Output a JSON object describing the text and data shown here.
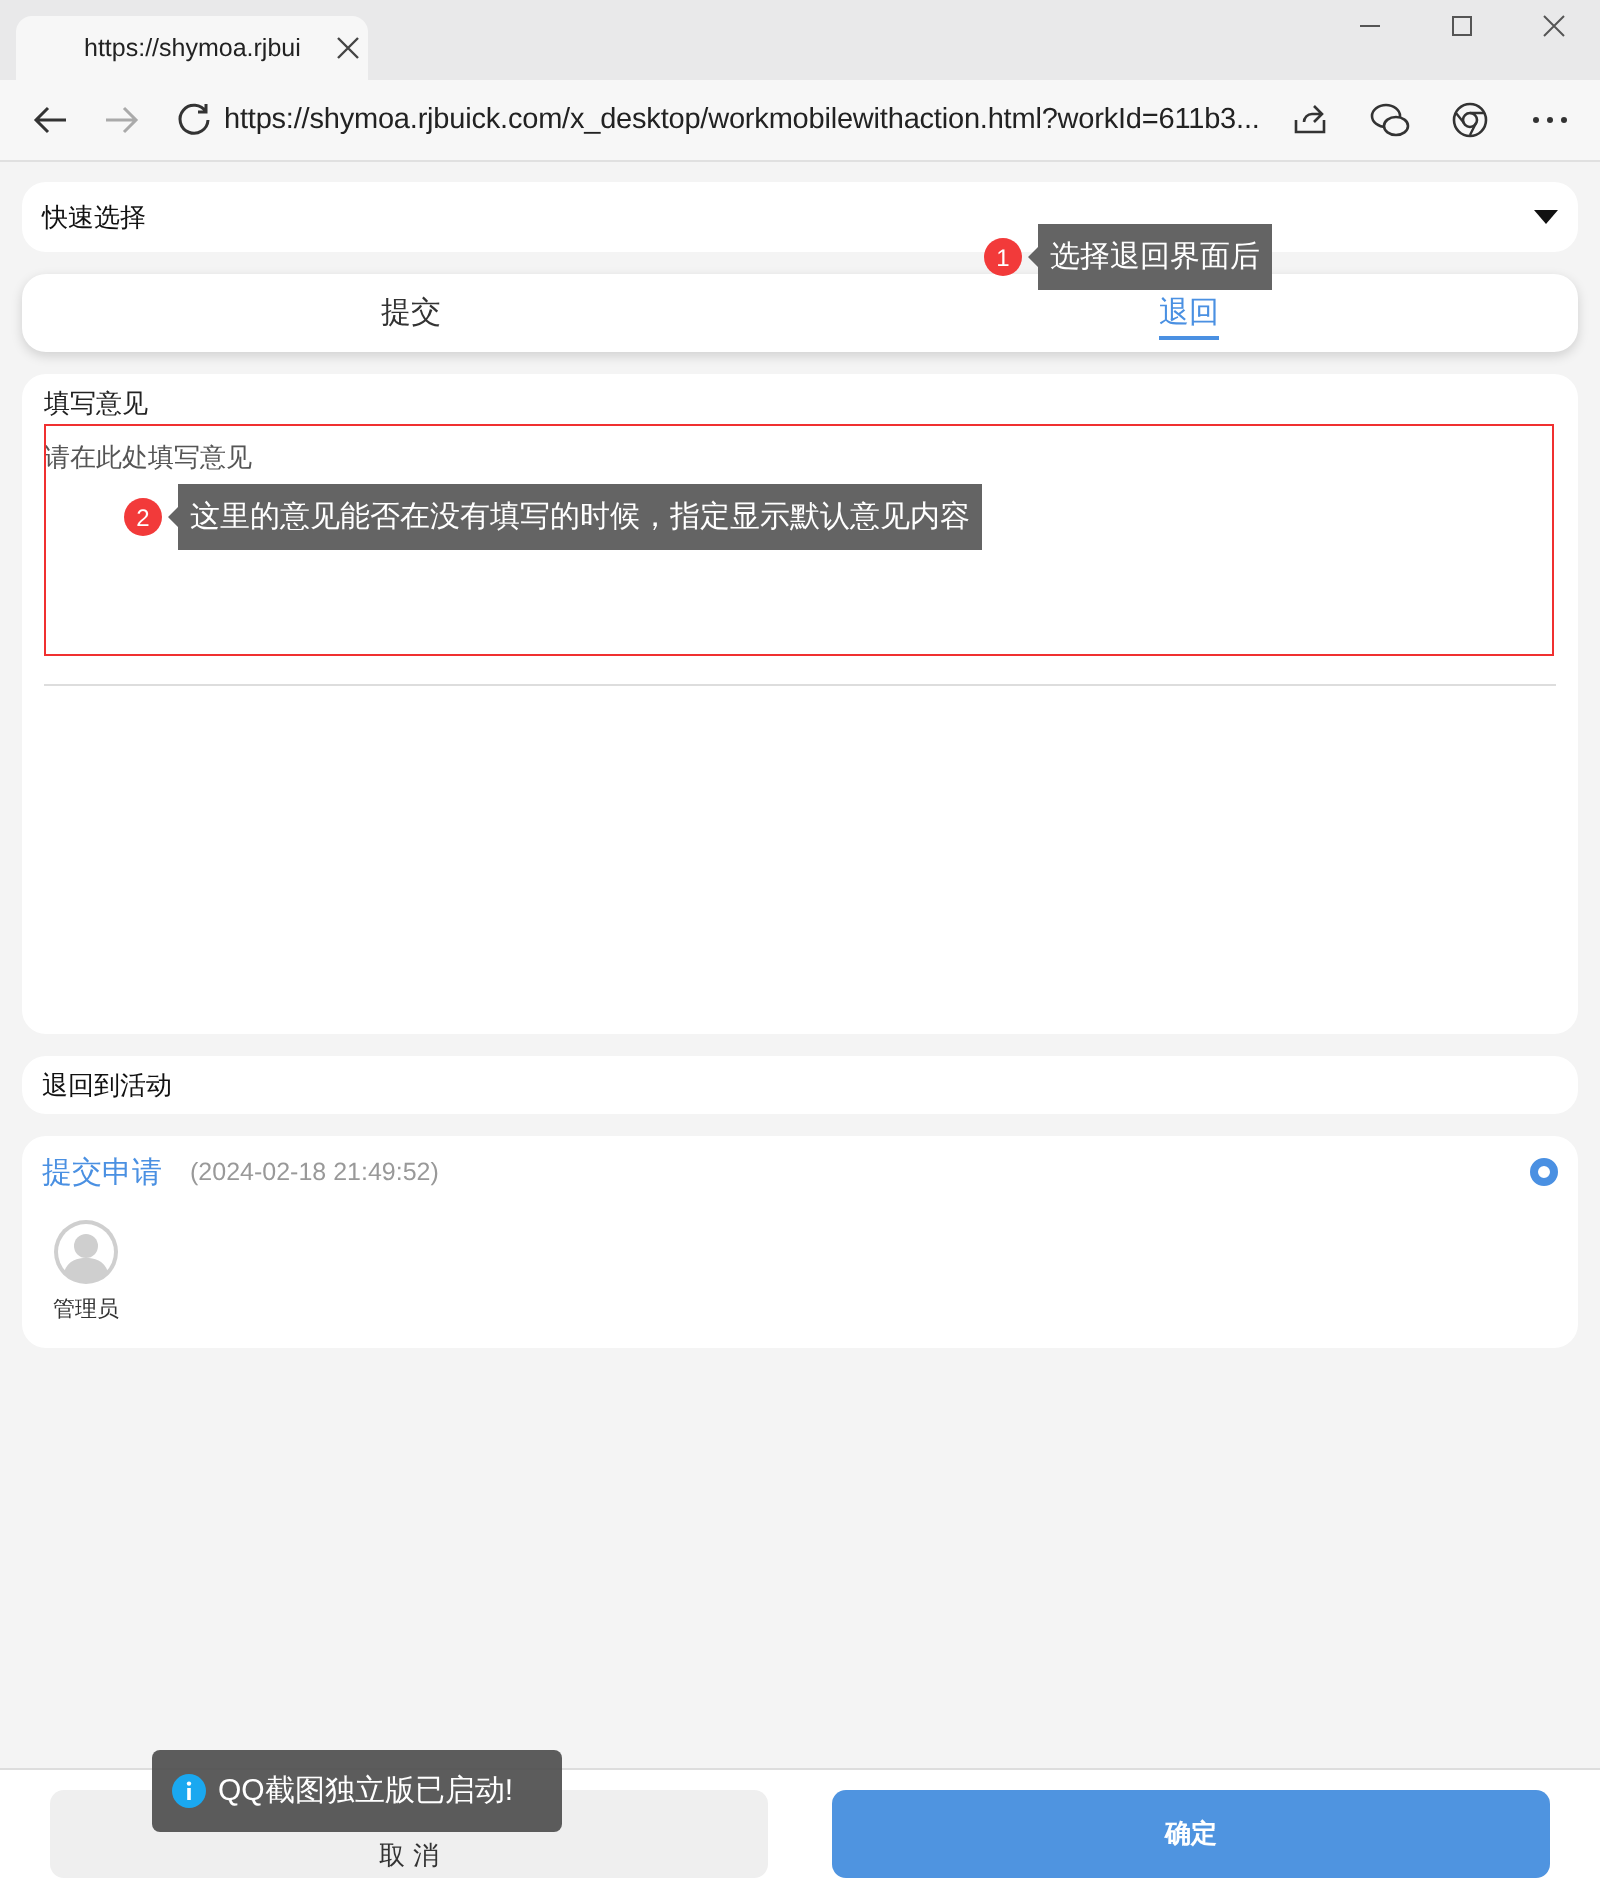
{
  "browser": {
    "tab_title": "https://shymoa.rjbui",
    "url": "https://shymoa.rjbuick.com/x_desktop/workmobilewithaction.html?workId=611b3..."
  },
  "quick_select": {
    "label": "快速选择"
  },
  "tabs": [
    {
      "label": "提交",
      "selected": false
    },
    {
      "label": "退回",
      "selected": true
    }
  ],
  "opinion": {
    "title": "填写意见",
    "placeholder": "请在此处填写意见"
  },
  "return_to": {
    "label": "退回到活动"
  },
  "activities": [
    {
      "name": "提交申请",
      "time": "(2024-02-18 21:49:52)",
      "selected": true,
      "person": "管理员"
    }
  ],
  "buttons": [
    {
      "label": "取 消",
      "kind": "secondary"
    },
    {
      "label": "确定",
      "kind": "primary"
    }
  ],
  "annotations": [
    {
      "number": "1",
      "text": "选择退回界面后"
    },
    {
      "number": "2",
      "text": "这里的意见能否在没有填写的时候，指定显示默认意见内容"
    }
  ],
  "toast": {
    "text": "QQ截图独立版已启动!"
  }
}
